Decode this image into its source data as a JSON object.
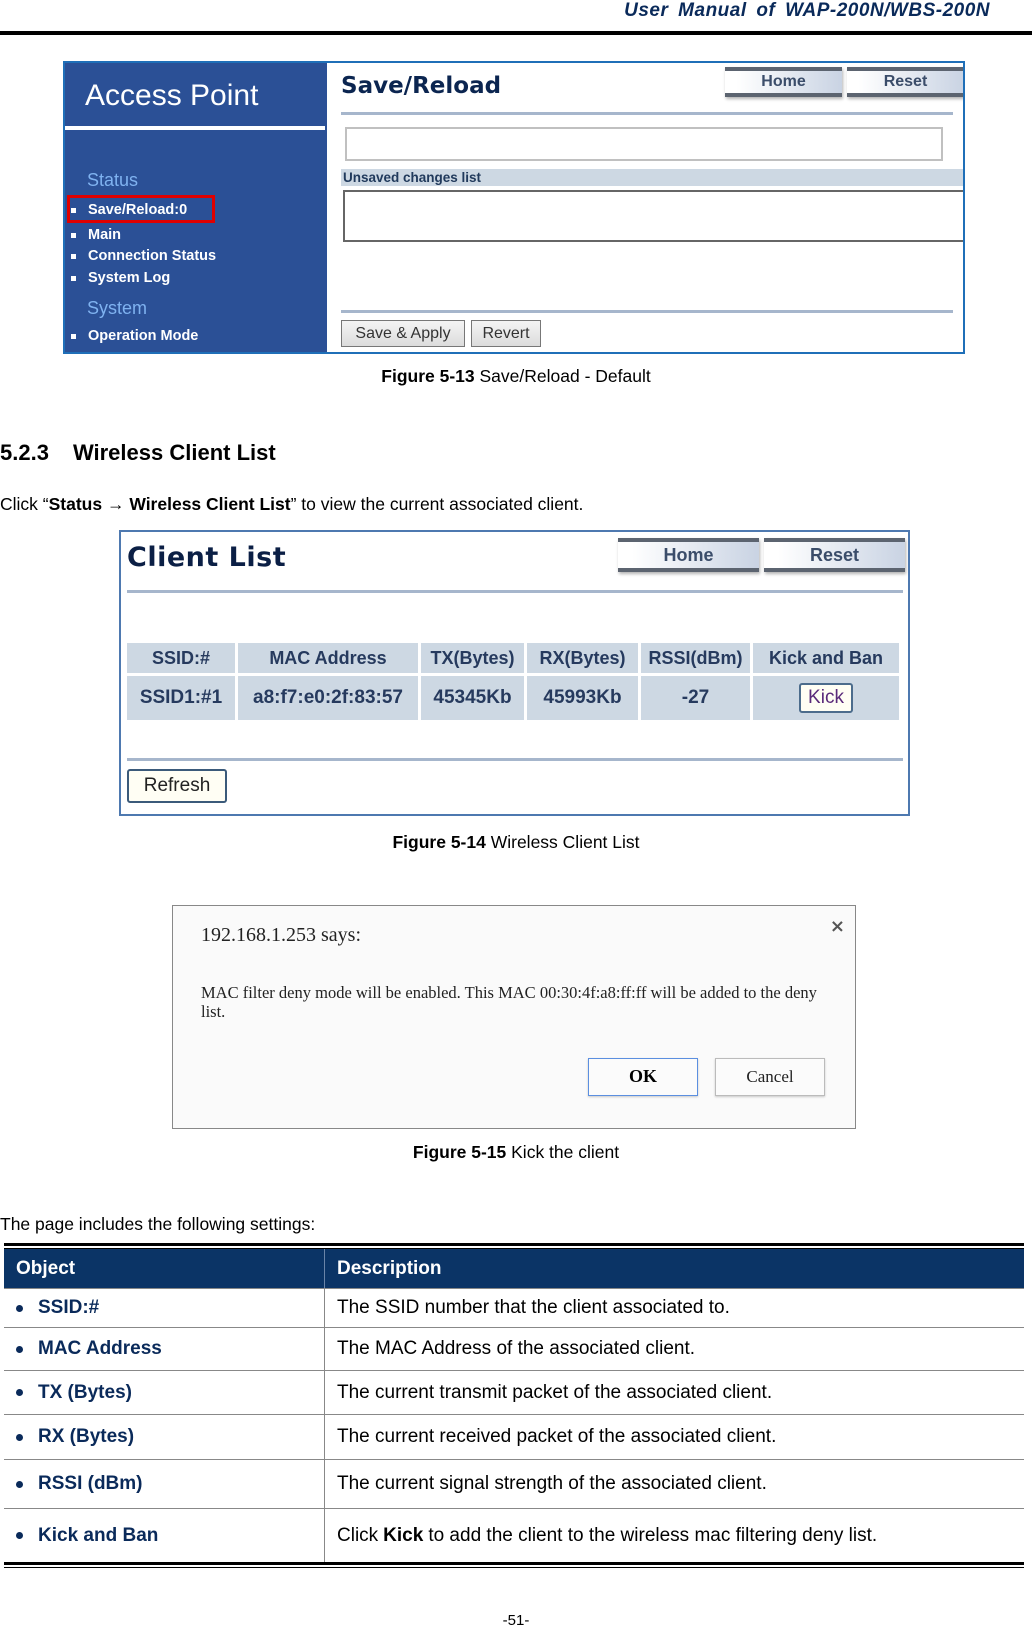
{
  "header": {
    "title": "User  Manual  of  WAP-200N/WBS-200N"
  },
  "figure1": {
    "brand": "Access Point",
    "sidebar": {
      "sections": [
        {
          "label": "Status",
          "items": [
            "Save/Reload:0",
            "Main",
            "Connection Status",
            "System Log"
          ]
        },
        {
          "label": "System",
          "items": [
            "Operation Mode"
          ]
        }
      ],
      "highlighted_item": "Save/Reload:0"
    },
    "page_title": "Save/Reload",
    "home_label": "Home",
    "reset_label": "Reset",
    "input_value": "",
    "unsaved_label": "Unsaved changes list",
    "unsaved_list": "",
    "save_apply_label": "Save & Apply",
    "revert_label": "Revert",
    "caption_num": "Figure 5-13",
    "caption_text": " Save/Reload - Default"
  },
  "section": {
    "number": "5.2.3",
    "title": "Wireless Client List",
    "intro_pre": "Click “",
    "intro_b1": "Status ",
    "intro_arrow": "→",
    "intro_b2": " Wireless Client List",
    "intro_post": "” to view the current associated client."
  },
  "figure2": {
    "page_title": "Client List",
    "home_label": "Home",
    "reset_label": "Reset",
    "columns": [
      "SSID:#",
      "MAC Address",
      "TX(Bytes)",
      "RX(Bytes)",
      "RSSI(dBm)",
      "Kick and Ban"
    ],
    "rows": [
      {
        "ssid": "SSID1:#1",
        "mac": "a8:f7:e0:2f:83:57",
        "tx": "45345Kb",
        "rx": "45993Kb",
        "rssi": "-27",
        "action": "Kick"
      }
    ],
    "refresh_label": "Refresh",
    "caption_num": "Figure 5-14",
    "caption_text": " Wireless Client List"
  },
  "figure3": {
    "title": "192.168.1.253 says:",
    "close": "×",
    "message": "MAC filter deny mode will be enabled. This MAC 00:30:4f:a8:ff:ff will be added to the deny list.",
    "ok_label": "OK",
    "cancel_label": "Cancel",
    "caption_num": "Figure 5-15",
    "caption_text": " Kick the client"
  },
  "settings": {
    "intro": "The page includes the following settings:",
    "headers": [
      "Object",
      "Description"
    ],
    "rows": [
      {
        "object": "SSID:#",
        "desc": "The SSID number that the client associated to."
      },
      {
        "object": "MAC Address",
        "desc": "The MAC Address of the associated client."
      },
      {
        "object": "TX (Bytes)",
        "desc": "The current transmit packet of the associated client."
      },
      {
        "object": "RX (Bytes)",
        "desc": "The current received packet of the associated client."
      },
      {
        "object": "RSSI (dBm)",
        "desc": "The current signal strength of the associated client."
      },
      {
        "object": "Kick and Ban",
        "desc_pre": "Click ",
        "desc_bold": "Kick",
        "desc_post": " to add the client to the wireless mac filtering deny list."
      }
    ]
  },
  "footer": {
    "page_number": "-51-"
  },
  "colors": {
    "sidebar_blue": "#2b5096",
    "table_header_navy": "#0b3466",
    "highlight_red": "#e00000",
    "object_text": "#0a2a5a"
  }
}
